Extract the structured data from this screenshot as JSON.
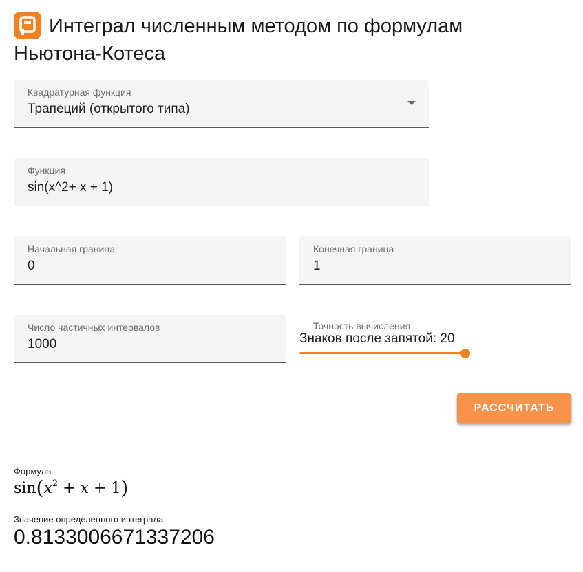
{
  "header": {
    "title": "Интеграл численным методом по формулам Ньютона-Котеса",
    "logo_color": "#f4801f",
    "logo_icon": "planetcalc-logo-icon"
  },
  "form": {
    "quadrature": {
      "label": "Квадратурная функция",
      "value": "Трапеций (открытого типа)"
    },
    "function": {
      "label": "Функция",
      "value": "sin(x^2+ x + 1)"
    },
    "lower_bound": {
      "label": "Начальная граница",
      "value": "0"
    },
    "upper_bound": {
      "label": "Конечная граница",
      "value": "1"
    },
    "intervals": {
      "label": "Число частичных интервалов",
      "value": "1000"
    },
    "precision": {
      "caption": "Точность вычисления",
      "label": "Знаков после запятой: 20",
      "value": 20,
      "max": 20,
      "fill_fraction": 1.0
    },
    "calculate_label": "РАССЧИТАТЬ",
    "accent_color": "#f4801f"
  },
  "results": {
    "formula_label": "Формула",
    "formula": {
      "func": "sin",
      "var": "x",
      "power": "2",
      "rest": "+ x + 1"
    },
    "integral_label": "Значение определенного интеграла",
    "integral_value": "0.8133006671337206"
  }
}
